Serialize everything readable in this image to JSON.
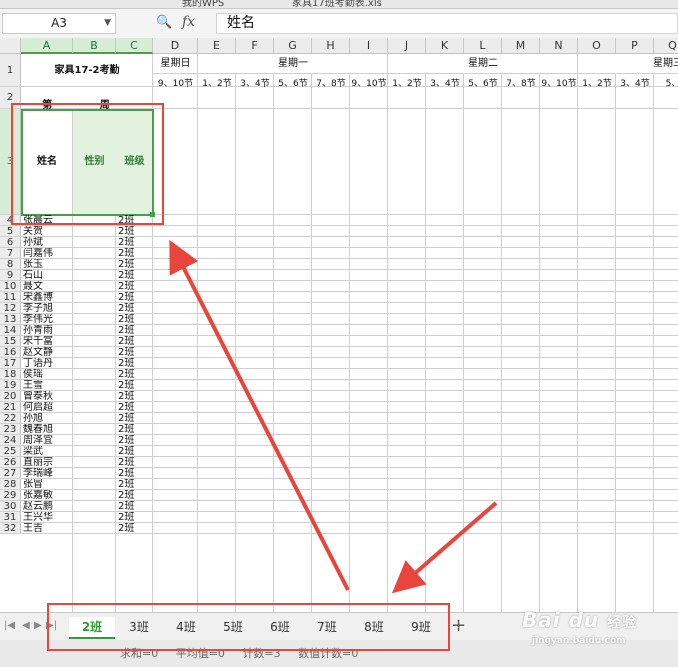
{
  "window": {
    "tabs": [
      {
        "label": "我的WPS"
      },
      {
        "label": "家具17班考勤表.xls"
      }
    ]
  },
  "formula_bar": {
    "cell_ref": "A3",
    "fx_label": "fx",
    "content": "姓名"
  },
  "grid": {
    "columns": [
      "A",
      "B",
      "C",
      "D",
      "E",
      "F",
      "G",
      "H",
      "I",
      "J",
      "K",
      "L",
      "M",
      "N",
      "O",
      "P",
      "Q"
    ],
    "selected_columns": [
      "A",
      "B",
      "C"
    ],
    "rows": [
      "1",
      "2",
      "3",
      "4",
      "5",
      "6",
      "7",
      "8",
      "9",
      "10",
      "11",
      "12",
      "13",
      "14",
      "15",
      "16",
      "17",
      "18",
      "19",
      "20",
      "21",
      "22",
      "23",
      "24",
      "25",
      "26",
      "27",
      "28",
      "29",
      "30",
      "31",
      "32"
    ]
  },
  "sheet": {
    "title": "家具17-2考勤",
    "week_label": "第 周",
    "header_name": "姓名",
    "header_gender": "性别",
    "header_class": "班级",
    "days": [
      {
        "label": "星期日",
        "periods": [
          "9、10节"
        ]
      },
      {
        "label": "星期一",
        "periods": [
          "1、2节",
          "3、4节",
          "5、6节",
          "7、8节",
          "9、10节"
        ]
      },
      {
        "label": "星期二",
        "periods": [
          "1、2节",
          "3、4节",
          "5、6节",
          "7、8节",
          "9、10节"
        ]
      },
      {
        "label": "星期三",
        "periods": [
          "1、2节",
          "3、4节",
          "5、"
        ]
      }
    ],
    "students": [
      {
        "name": "张晨云",
        "class": "2班"
      },
      {
        "name": "关贺",
        "class": "2班"
      },
      {
        "name": "孙斌",
        "class": "2班"
      },
      {
        "name": "闫嘉伟",
        "class": "2班"
      },
      {
        "name": "张玉",
        "class": "2班"
      },
      {
        "name": "石山",
        "class": "2班"
      },
      {
        "name": "聂文",
        "class": "2班"
      },
      {
        "name": "宋鑫博",
        "class": "2班"
      },
      {
        "name": "李子旭",
        "class": "2班"
      },
      {
        "name": "李伟光",
        "class": "2班"
      },
      {
        "name": "孙青雨",
        "class": "2班"
      },
      {
        "name": "宋千富",
        "class": "2班"
      },
      {
        "name": "赵文静",
        "class": "2班"
      },
      {
        "name": "丁语丹",
        "class": "2班"
      },
      {
        "name": "侯瑶",
        "class": "2班"
      },
      {
        "name": "王雪",
        "class": "2班"
      },
      {
        "name": "曾泰秋",
        "class": "2班"
      },
      {
        "name": "何启超",
        "class": "2班"
      },
      {
        "name": "孙旭",
        "class": "2班"
      },
      {
        "name": "魏春旭",
        "class": "2班"
      },
      {
        "name": "周泽宜",
        "class": "2班"
      },
      {
        "name": "梁武",
        "class": "2班"
      },
      {
        "name": "直丽宗",
        "class": "2班"
      },
      {
        "name": "李瑞峰",
        "class": "2班"
      },
      {
        "name": "张冒",
        "class": "2班"
      },
      {
        "name": "张嘉敏",
        "class": "2班"
      },
      {
        "name": "赵云鹏",
        "class": "2班"
      },
      {
        "name": "王兴华",
        "class": "2班"
      },
      {
        "name": "王吉",
        "class": "2班"
      }
    ]
  },
  "sheet_tabs": [
    "2班",
    "3班",
    "4班",
    "5班",
    "6班",
    "7班",
    "8班",
    "9班"
  ],
  "active_sheet": "2班",
  "status": {
    "sum": "求和=0",
    "avg": "平均值=0",
    "count": "计数=3",
    "numcount": "数值计数=0"
  },
  "watermark": {
    "brand": "Bai du",
    "sub": "经验",
    "url": "jingyan.baidu.com"
  },
  "colors": {
    "highlight": "#e8453c",
    "selection": "#4a9e48",
    "active_tab": "#2f9b3c"
  }
}
